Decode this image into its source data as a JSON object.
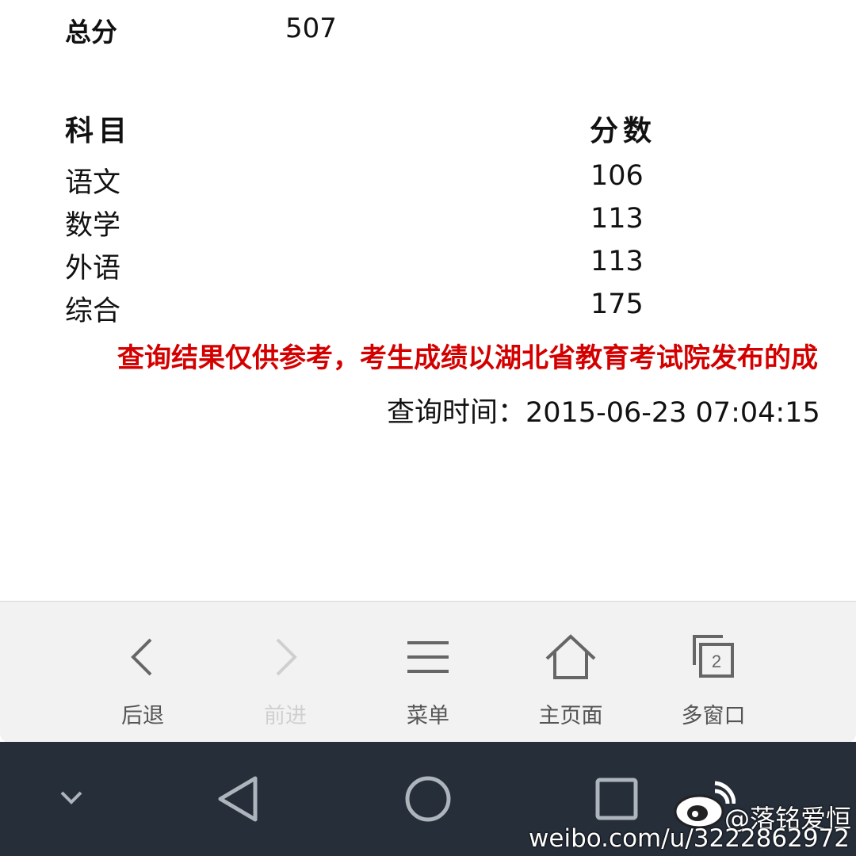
{
  "result": {
    "total_label": "总分",
    "total_value": "507",
    "header_subject": "科目",
    "header_score": "分数",
    "rows": [
      {
        "subject": "语文",
        "score": "106"
      },
      {
        "subject": "数学",
        "score": "113"
      },
      {
        "subject": "外语",
        "score": "113"
      },
      {
        "subject": "综合",
        "score": "175"
      }
    ],
    "notice": "查询结果仅供参考，考生成绩以湖北省教育考试院发布的成",
    "query_time": "查询时间：2015-06-23 07:04:15"
  },
  "toolbar": {
    "back_label": "后退",
    "forward_label": "前进",
    "menu_label": "菜单",
    "home_label": "主页面",
    "windows_label": "多窗口",
    "windows_count": "2"
  },
  "watermark": {
    "user": "@落铭爱恒",
    "url": "weibo.com/u/3222862972"
  },
  "colors": {
    "notice": "#d40000",
    "toolbar_bg": "#f2f2f2",
    "navbar_bg": "#262e3a"
  }
}
